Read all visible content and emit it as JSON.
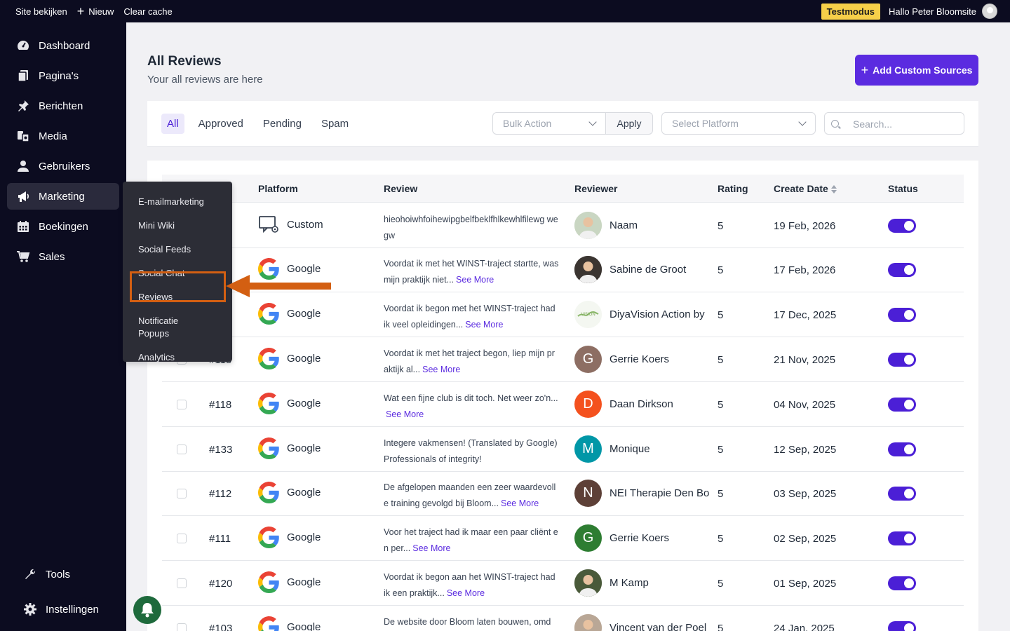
{
  "topbar": {
    "site_label": "Site bekijken",
    "new_label": "Nieuw",
    "cache_label": "Clear cache",
    "testmode_label": "Testmodus",
    "howdy_label": "Hallo Peter Bloomsite"
  },
  "sidebar": {
    "items": [
      {
        "label": "Dashboard",
        "icon": "dashboard-icon"
      },
      {
        "label": "Pagina's",
        "icon": "pages-icon"
      },
      {
        "label": "Berichten",
        "icon": "pin-icon"
      },
      {
        "label": "Media",
        "icon": "media-icon"
      },
      {
        "label": "Gebruikers",
        "icon": "user-icon"
      },
      {
        "label": "Marketing",
        "icon": "megaphone-icon"
      },
      {
        "label": "Boekingen",
        "icon": "calendar-icon"
      },
      {
        "label": "Sales",
        "icon": "cart-icon"
      }
    ],
    "bottom": [
      {
        "label": "Tools",
        "icon": "wrench-icon"
      },
      {
        "label": "Instellingen",
        "icon": "gear-icon"
      }
    ]
  },
  "flyout": {
    "items": [
      "E-mailmarketing",
      "Mini Wiki",
      "Social Feeds",
      "Social Chat",
      "Reviews",
      "Notificatie Popups",
      "Analytics"
    ]
  },
  "header": {
    "title": "All Reviews",
    "subtitle": "Your all reviews are here",
    "add_button": "Add Custom Sources"
  },
  "filters": {
    "tabs": [
      "All",
      "Approved",
      "Pending",
      "Spam"
    ],
    "bulk_placeholder": "Bulk Action",
    "apply_label": "Apply",
    "platform_placeholder": "Select Platform",
    "search_placeholder": "Search..."
  },
  "table": {
    "headers": {
      "platform": "Platform",
      "review": "Review",
      "reviewer": "Reviewer",
      "rating": "Rating",
      "date": "Create Date",
      "status": "Status"
    },
    "see_more": "See More",
    "rows": [
      {
        "id": "",
        "platform": "Custom",
        "review": "hieohoiwhfoihewipgbelfbeklfhlkewhlfilewg wegw",
        "more": false,
        "reviewer": "Naam",
        "rating": "5",
        "date": "19 Feb, 2026",
        "status": true,
        "avatar": "photo",
        "avatar_color": "#c9d6c2"
      },
      {
        "id": "",
        "platform": "Google",
        "review": "Voordat ik met het WINST-traject startte, was mijn praktijk niet...",
        "more": true,
        "reviewer": "Sabine de Groot",
        "rating": "5",
        "date": "17 Feb, 2026",
        "status": true,
        "avatar": "photo",
        "avatar_color": "#3b3531"
      },
      {
        "id": "",
        "platform": "Google",
        "review": "Voordat ik begon met het WINST-traject had ik veel opleidingen...",
        "more": true,
        "reviewer": "DiyaVision Action by",
        "rating": "5",
        "date": "17 Dec, 2025",
        "status": true,
        "avatar": "logo",
        "avatar_color": "#f4f7f1"
      },
      {
        "id": "#115",
        "platform": "Google",
        "review": "Voordat ik met het traject begon, liep mijn praktijk al...",
        "more": true,
        "reviewer": "Gerrie Koers",
        "rating": "5",
        "date": "21 Nov, 2025",
        "status": true,
        "avatar": "G",
        "avatar_color": "#8d6e63"
      },
      {
        "id": "#118",
        "platform": "Google",
        "review": "Wat een fijne club is dit toch. Net weer zo'n...",
        "more": true,
        "reviewer": "Daan Dirkson",
        "rating": "5",
        "date": "04 Nov, 2025",
        "status": true,
        "avatar": "D",
        "avatar_color": "#f4511e"
      },
      {
        "id": "#133",
        "platform": "Google",
        "review": "Integere vakmensen! (Translated by Google) Professionals of integrity!",
        "more": false,
        "reviewer": "Monique",
        "rating": "5",
        "date": "12 Sep, 2025",
        "status": true,
        "avatar": "M",
        "avatar_color": "#0097a7"
      },
      {
        "id": "#112",
        "platform": "Google",
        "review": "De afgelopen maanden een zeer waardevolle training gevolgd bij Bloom...",
        "more": true,
        "reviewer": "NEI Therapie Den Bosch",
        "rating": "5",
        "date": "03 Sep, 2025",
        "status": true,
        "avatar": "N",
        "avatar_color": "#5d4037"
      },
      {
        "id": "#111",
        "platform": "Google",
        "review": "Voor het traject had ik maar een paar cliënt en per...",
        "more": true,
        "reviewer": "Gerrie Koers",
        "rating": "5",
        "date": "02 Sep, 2025",
        "status": true,
        "avatar": "G",
        "avatar_color": "#2e7d32"
      },
      {
        "id": "#120",
        "platform": "Google",
        "review": "Voordat ik begon aan het WINST-traject had ik een praktijk...",
        "more": true,
        "reviewer": "M Kamp",
        "rating": "5",
        "date": "01 Sep, 2025",
        "status": true,
        "avatar": "photo",
        "avatar_color": "#4a5a3a"
      },
      {
        "id": "#103",
        "platform": "Google",
        "review": "De website door Bloom laten bouwen, omd",
        "more": false,
        "reviewer": "Vincent van der Poel",
        "rating": "5",
        "date": "24 Jan, 2025",
        "status": true,
        "avatar": "photo",
        "avatar_color": "#b9a796"
      }
    ]
  },
  "colors": {
    "accent": "#5b2be0",
    "sidebar": "#0c0c20",
    "highlight": "#d35f12",
    "testmode": "#f6cf49"
  }
}
